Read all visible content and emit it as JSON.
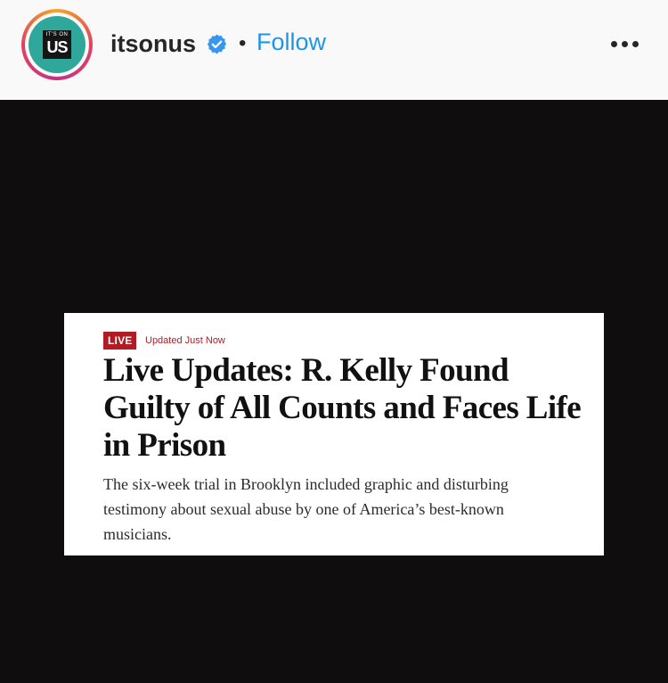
{
  "post_header": {
    "username": "itsonus",
    "separator": "•",
    "follow_label": "Follow",
    "avatar": {
      "logo_small_text": "IT'S ON",
      "logo_big_text": "US",
      "ring_colors": [
        "#f5a623",
        "#e4405f",
        "#c13584"
      ],
      "background_color": "#2fa89b"
    },
    "verified_icon": "verified-badge-icon",
    "more_icon": "more-options-icon",
    "follow_color": "#1f95e8"
  },
  "article_card": {
    "live_badge": "LIVE",
    "updated_text": "Updated Just Now",
    "headline": "Live Updates: R. Kelly Found Guilty of All Counts and Faces Life in Prison",
    "summary": "The six-week trial in Brooklyn included graphic and disturbing testimony about sexual abuse by one of America’s best-known musicians.",
    "accent_color": "#b11b23"
  }
}
